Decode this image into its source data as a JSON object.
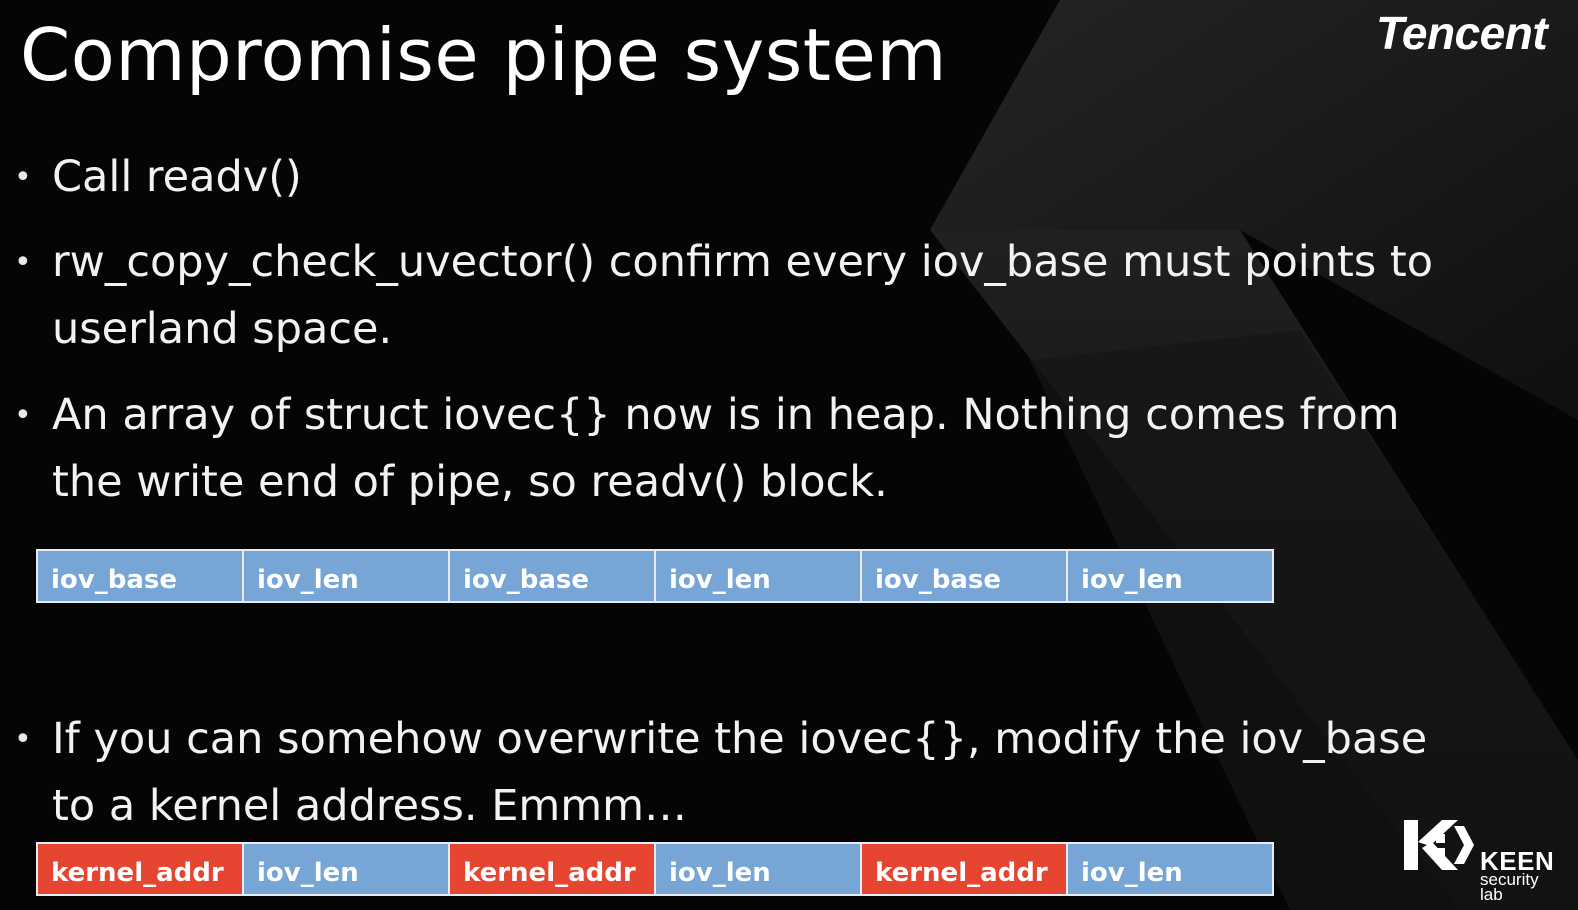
{
  "slide": {
    "title": "Compromise pipe system",
    "brand": "Tencent",
    "bullets": [
      "Call readv()",
      "rw_copy_check_uvector() confirm every iov_base must points to\nuserland space.",
      "An array of struct iovec{} now is in heap. Nothing comes from\nthe write end of pipe, so readv() block.",
      "If you can somehow overwrite the iovec{}, modify the iov_base\nto a kernel address. Emmm…"
    ],
    "bullet_symbol": "•"
  },
  "iovec_array": {
    "cells": [
      "iov_base",
      "iov_len",
      "iov_base",
      "iov_len",
      "iov_base",
      "iov_len"
    ],
    "fill_color": "#76a5d6"
  },
  "overwritten_array": {
    "cells": [
      "kernel_addr",
      "iov_len",
      "kernel_addr",
      "iov_len",
      "kernel_addr",
      "iov_len"
    ],
    "kernel_color": "#e54531",
    "len_color": "#76a5d6"
  },
  "logo": {
    "name": "KEEN",
    "sub_line1": "security",
    "sub_line2": "lab",
    "icon": "keen-k-icon"
  },
  "colors": {
    "background": "#050505",
    "text": "#f2f2f2"
  }
}
